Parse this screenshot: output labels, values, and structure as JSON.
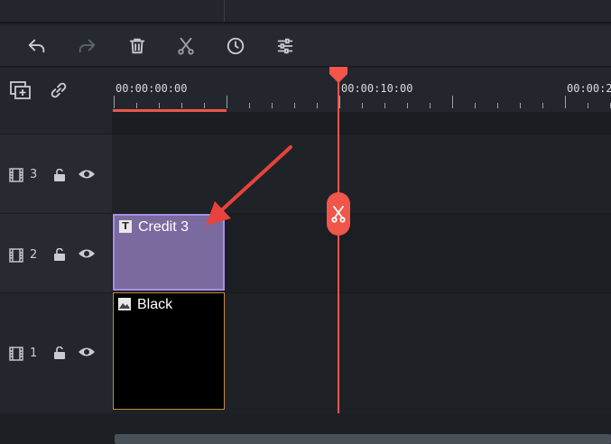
{
  "ruler": {
    "timecodes": [
      "00:00:00:00",
      "00:00:10:00",
      "00:00:20"
    ]
  },
  "toolbar": {
    "buttons": [
      "undo-icon",
      "redo-icon",
      "delete-icon",
      "cut-icon",
      "speed-icon",
      "adjust-icon"
    ]
  },
  "tracks": [
    {
      "number": "3"
    },
    {
      "number": "2"
    },
    {
      "number": "1"
    }
  ],
  "clips": {
    "credit": {
      "label": "Credit 3",
      "icon": "T",
      "color": "#7b6a9f",
      "border": "#a98de6"
    },
    "black": {
      "label": "Black",
      "color": "#000000",
      "border": "#c98a3a"
    }
  },
  "colors": {
    "accent": "#f0564a",
    "annotation": "#e8423c"
  }
}
